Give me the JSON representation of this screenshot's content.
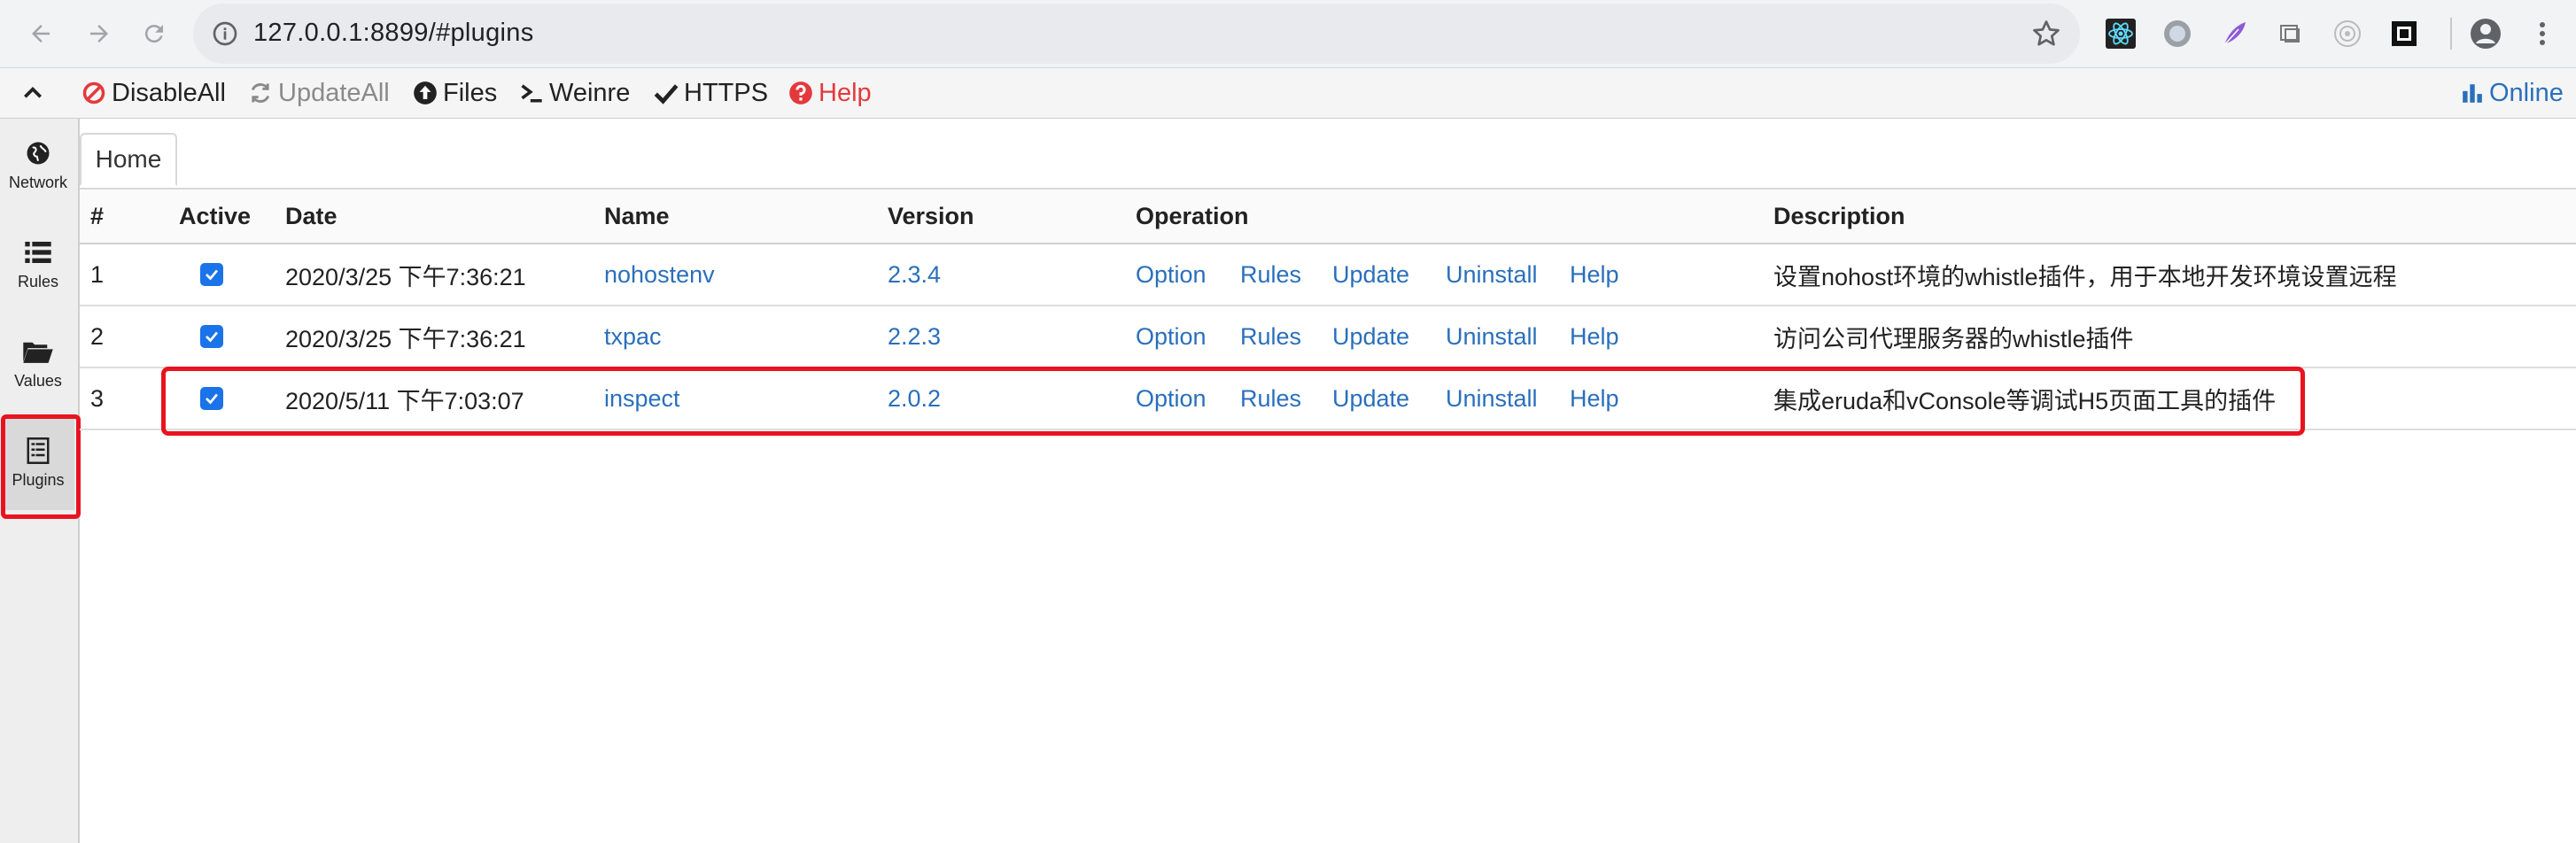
{
  "browser": {
    "url": "127.0.0.1:8899/#plugins"
  },
  "toolbar": {
    "disable_all": "DisableAll",
    "update_all": "UpdateAll",
    "files": "Files",
    "weinre": "Weinre",
    "https": "HTTPS",
    "help": "Help",
    "online": "Online"
  },
  "sidebar": {
    "items": [
      {
        "label": "Network",
        "icon": "globe-icon"
      },
      {
        "label": "Rules",
        "icon": "list-icon"
      },
      {
        "label": "Values",
        "icon": "folder-icon"
      },
      {
        "label": "Plugins",
        "icon": "document-list-icon",
        "active": true
      }
    ]
  },
  "tabs": [
    {
      "label": "Home",
      "active": true
    }
  ],
  "table": {
    "headers": {
      "index": "#",
      "active": "Active",
      "date": "Date",
      "name": "Name",
      "version": "Version",
      "operation": "Operation",
      "description": "Description"
    },
    "rows": [
      {
        "index": "1",
        "active": true,
        "date": "2020/3/25 下午7:36:21",
        "name": "nohostenv",
        "version": "2.3.4",
        "ops": {
          "option": "Option",
          "rules": "Rules",
          "update": "Update",
          "uninstall": "Uninstall",
          "help": "Help"
        },
        "description": "设置nohost环境的whistle插件，用于本地开发环境设置远程"
      },
      {
        "index": "2",
        "active": true,
        "date": "2020/3/25 下午7:36:21",
        "name": "txpac",
        "version": "2.2.3",
        "ops": {
          "option": "Option",
          "rules": "Rules",
          "update": "Update",
          "uninstall": "Uninstall",
          "help": "Help"
        },
        "description": "访问公司代理服务器的whistle插件"
      },
      {
        "index": "3",
        "active": true,
        "date": "2020/5/11 下午7:03:07",
        "name": "inspect",
        "version": "2.0.2",
        "ops": {
          "option": "Option",
          "rules": "Rules",
          "update": "Update",
          "uninstall": "Uninstall",
          "help": "Help"
        },
        "description": "集成eruda和vConsole等调试H5页面工具的插件"
      }
    ]
  },
  "colors": {
    "link": "#2a6fbc",
    "highlight": "#e8131f",
    "checkbox": "#1a73e8",
    "danger": "#e4393c"
  }
}
